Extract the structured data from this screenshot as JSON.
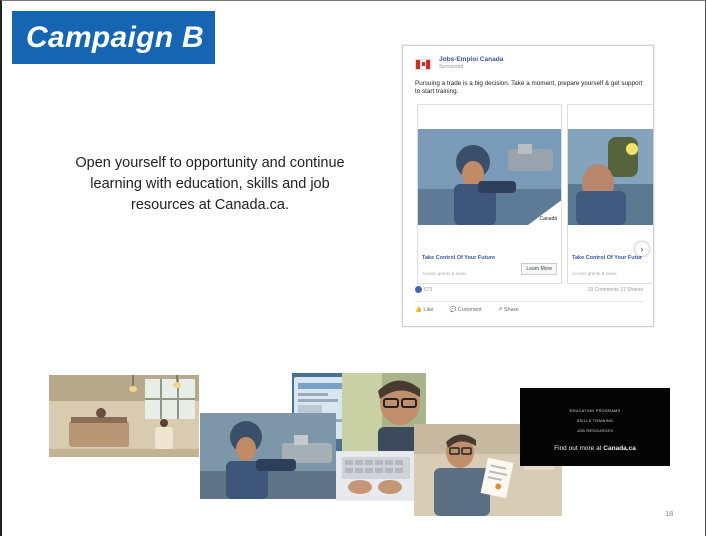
{
  "slide": {
    "title": "Campaign B",
    "body_text": "Open yourself to opportunity and continue learning with education, skills and job resources at Canada.ca.",
    "page_number": "18"
  },
  "ad": {
    "brand": "Jobs-Emploi Canada",
    "sponsored": "Sponsored",
    "post_text": "Pursuing a trade is a big decision. Take a moment, prepare yourself & get support to start training.",
    "cards": [
      {
        "title": "Take Control Of Your Future",
        "subtitle": "Access grants & loans",
        "button": "Learn More",
        "watermark": "Canadä"
      },
      {
        "title": "Take Control Of Your Futur",
        "subtitle": "Access grants & loans"
      }
    ],
    "reaction_count": "673",
    "comments_shares": "33 Comments   17 Shares",
    "actions": [
      "Like",
      "Comment",
      "Share"
    ]
  },
  "end_card": {
    "lines": [
      "EDUCATION PROGRAMS",
      "SKILLS TRAINING",
      "JOB RESOURCES"
    ],
    "cta_prefix": "Find out more at",
    "cta_site": "Canada.ca"
  },
  "colors": {
    "title_blue": "#1565b3",
    "fb_link_blue": "#365899",
    "canada_red": "#d52b1e"
  }
}
